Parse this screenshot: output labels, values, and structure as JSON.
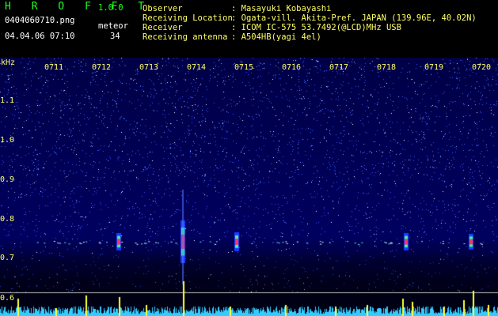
{
  "header": {
    "app_name": "H R O F F T",
    "version": "1.0.0",
    "filename": "0404060710.png",
    "meteor_label": "meteor",
    "datetime": "04.04.06 07:10",
    "meteor_count": "34",
    "info_keys": [
      "Observer",
      "Receiving Location",
      "Receiver",
      "Receiving antenna"
    ],
    "info_values": [
      ": Masayuki Kobayashi",
      ": Ogata-vill. Akita-Pref. JAPAN (139.96E, 40.02N)",
      ": ICOM IC-575 53.7492(@LCD)MHz USB",
      ": A504HB(yagi 4el)"
    ]
  },
  "spectrogram": {
    "y_unit": "kHz",
    "y_ticks": [
      "1.1",
      "1.0",
      "0.9",
      "0.8",
      "0.7",
      "0.6"
    ],
    "x_ticks": [
      "0711",
      "0712",
      "0713",
      "0714",
      "0715",
      "0716",
      "0717",
      "0718",
      "0719",
      "0720"
    ],
    "colors": {
      "background": "#000020",
      "signal": "#ffff33",
      "baseline": "#33ccff",
      "echo": "#ff3366",
      "echo_core": "#33ff99"
    },
    "meteor_echoes": [
      {
        "x_time": "07:13.9",
        "freq_khz": 0.745,
        "strength": 1.0
      },
      {
        "x_time": "07:15.0",
        "freq_khz": 0.755,
        "strength": 0.6
      },
      {
        "x_time": "07:12.6",
        "freq_khz": 0.745,
        "strength": 0.5
      },
      {
        "x_time": "07:18.6",
        "freq_khz": 0.748,
        "strength": 0.5
      },
      {
        "x_time": "07:19.9",
        "freq_khz": 0.745,
        "strength": 0.4
      }
    ]
  }
}
